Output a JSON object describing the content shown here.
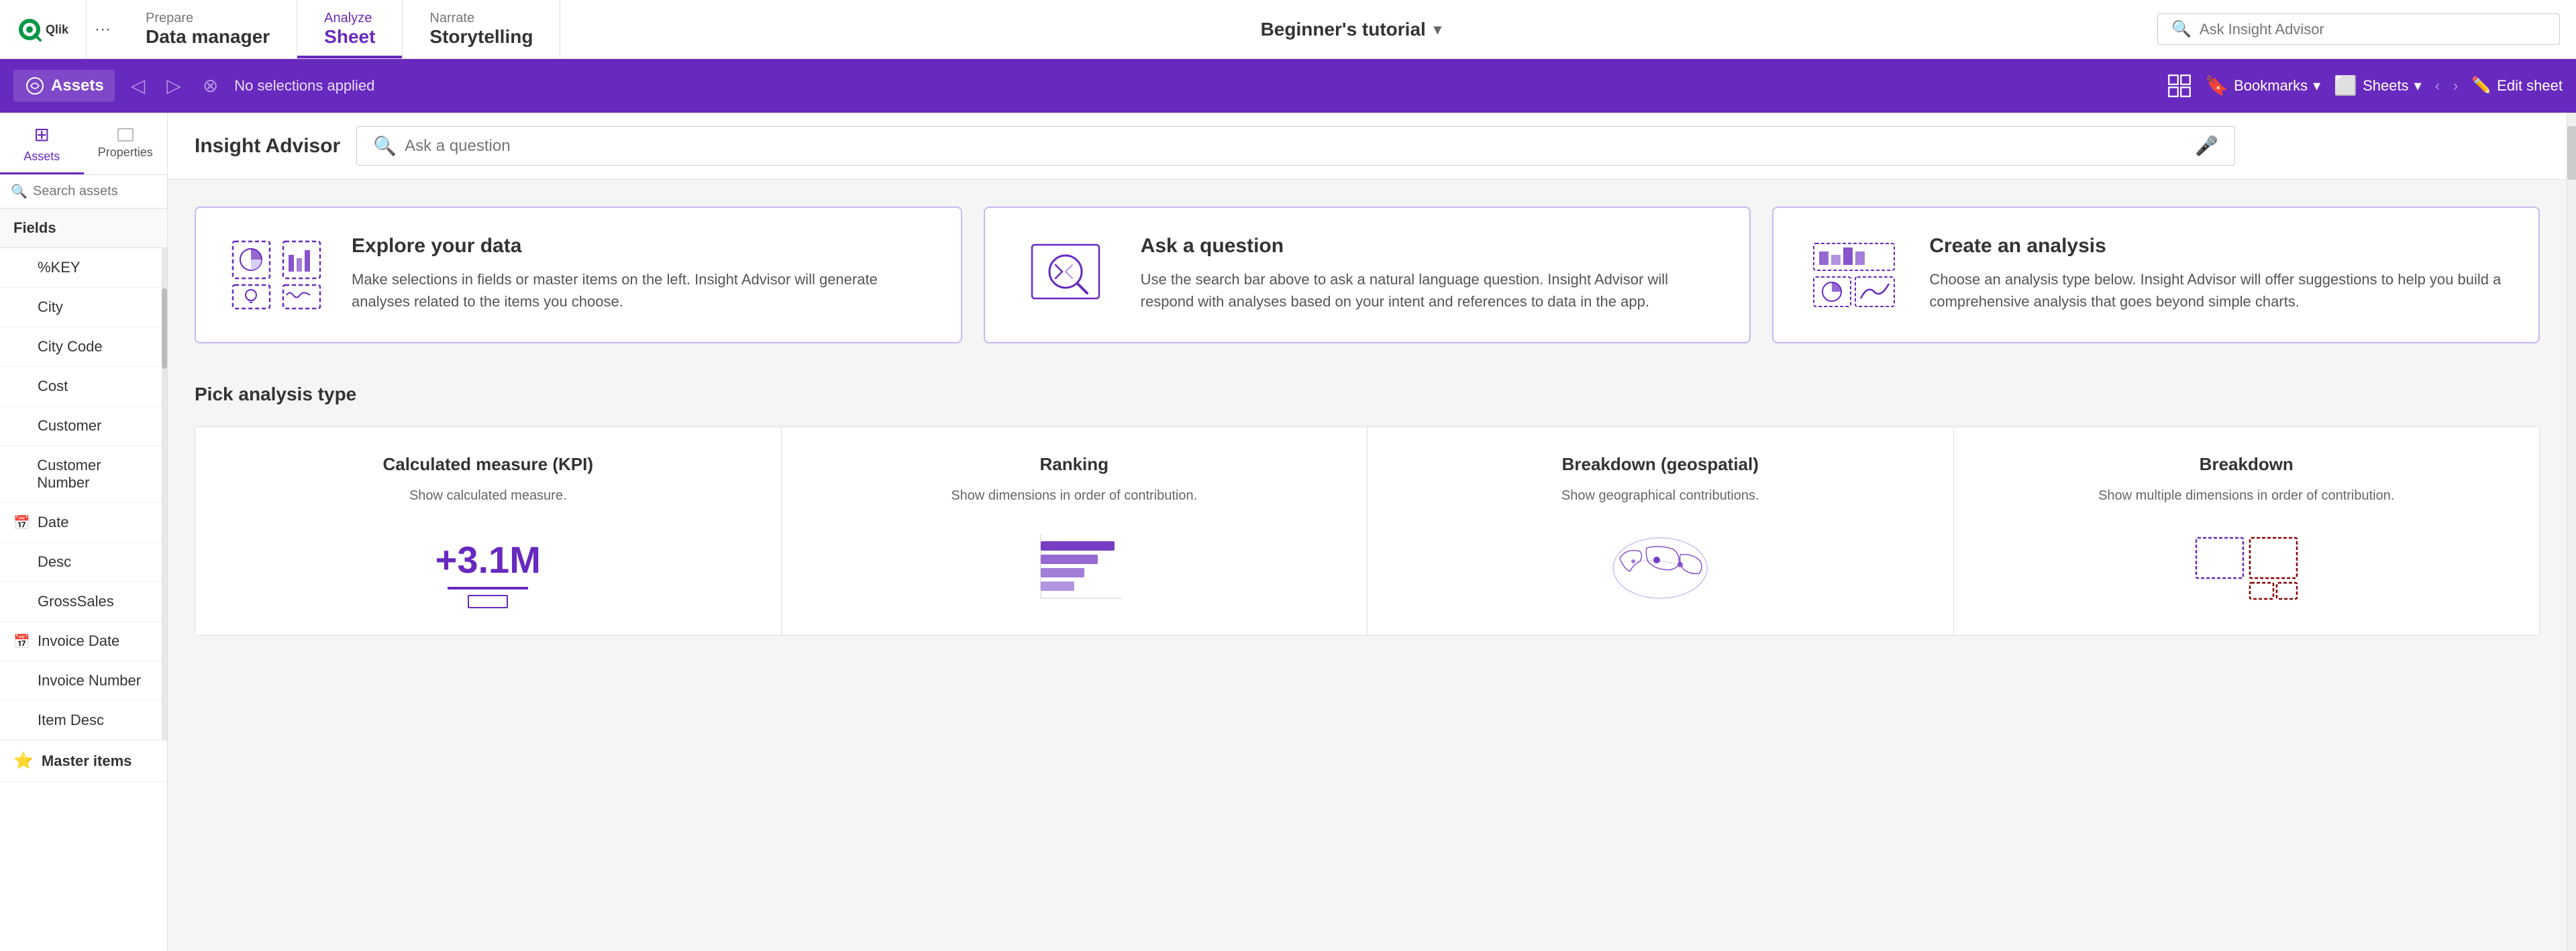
{
  "topNav": {
    "tabs": [
      {
        "id": "prepare",
        "label": "Prepare",
        "subLabel": "Data manager",
        "active": false
      },
      {
        "id": "analyze",
        "label": "Analyze",
        "subLabel": "Sheet",
        "active": true
      },
      {
        "id": "narrate",
        "label": "Narrate",
        "subLabel": "Storytelling",
        "active": false
      }
    ],
    "appTitle": "Beginner's tutorial",
    "askSearch": {
      "placeholder": "Ask Insight Advisor"
    }
  },
  "toolbar": {
    "noSelections": "No selections applied",
    "bookmarks": "Bookmarks",
    "sheets": "Sheets",
    "editSheet": "Edit sheet"
  },
  "leftPanel": {
    "tabs": [
      {
        "id": "assets",
        "label": "Assets"
      },
      {
        "id": "properties",
        "label": "Properties"
      }
    ],
    "searchPlaceholder": "Search assets",
    "fieldsHeader": "Fields",
    "fields": [
      {
        "name": "%KEY",
        "hasIcon": false
      },
      {
        "name": "City",
        "hasIcon": false
      },
      {
        "name": "City Code",
        "hasIcon": false
      },
      {
        "name": "Cost",
        "hasIcon": false
      },
      {
        "name": "Customer",
        "hasIcon": false
      },
      {
        "name": "Customer Number",
        "hasIcon": false
      },
      {
        "name": "Date",
        "hasIcon": true,
        "icon": "calendar"
      },
      {
        "name": "Desc",
        "hasIcon": false
      },
      {
        "name": "GrossSales",
        "hasIcon": false
      },
      {
        "name": "Invoice Date",
        "hasIcon": true,
        "icon": "calendar"
      },
      {
        "name": "Invoice Number",
        "hasIcon": false
      },
      {
        "name": "Item Desc",
        "hasIcon": false
      }
    ],
    "masterItems": "Master items"
  },
  "insightAdvisor": {
    "title": "Insight Advisor",
    "searchPlaceholder": "Ask a question"
  },
  "infoCards": [
    {
      "id": "explore",
      "title": "Explore your data",
      "description": "Make selections in fields or master items on the left. Insight Advisor will generate analyses related to the items you choose."
    },
    {
      "id": "ask",
      "title": "Ask a question",
      "description": "Use the search bar above to ask a natural language question. Insight Advisor will respond with analyses based on your intent and references to data in the app."
    },
    {
      "id": "create",
      "title": "Create an analysis",
      "description": "Choose an analysis type below. Insight Advisor will offer suggestions to help you build a comprehensive analysis that goes beyond simple charts."
    }
  ],
  "analysisSection": {
    "title": "Pick analysis type",
    "types": [
      {
        "id": "kpi",
        "title": "Calculated measure (KPI)",
        "description": "Show calculated measure.",
        "kpiValue": "+3.1M"
      },
      {
        "id": "ranking",
        "title": "Ranking",
        "description": "Show dimensions in order of contribution."
      },
      {
        "id": "geospatial",
        "title": "Breakdown (geospatial)",
        "description": "Show geographical contributions."
      },
      {
        "id": "breakdown",
        "title": "Breakdown",
        "description": "Show multiple dimensions in order of contribution."
      }
    ]
  },
  "colors": {
    "brand": "#6829bf",
    "brandLight": "#c8b8f0",
    "activeTab": "#6829bf"
  }
}
